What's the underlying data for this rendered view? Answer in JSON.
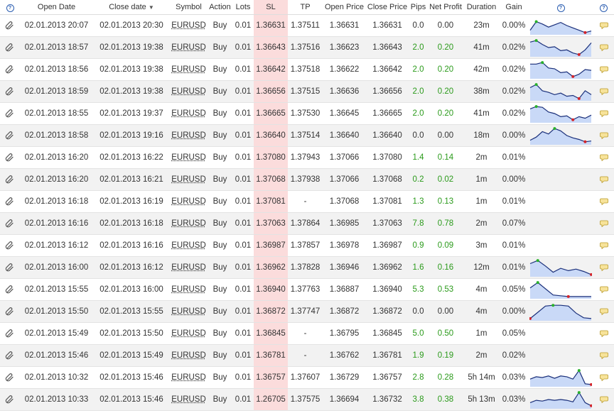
{
  "header": {
    "help_left": "?",
    "open_date": "Open Date",
    "close_date": "Close date",
    "sort_indicator": "▼",
    "symbol": "Symbol",
    "action": "Action",
    "lots": "Lots",
    "sl": "SL",
    "tp": "TP",
    "open_price": "Open Price",
    "close_price": "Close Price",
    "pips": "Pips",
    "net_profit": "Net Profit",
    "duration": "Duration",
    "gain": "Gain",
    "help_chart": "?",
    "help_right": "?"
  },
  "icons": {
    "row_left": "paperclip-icon",
    "row_right": "comment-bubble-icon"
  },
  "colors": {
    "sl_highlight": "#fbdcdc",
    "positive": "#2a9a1a",
    "spark_fill": "#c9d9f7",
    "spark_line": "#1a2f7a"
  },
  "rows": [
    {
      "open_date": "02.01.2013 20:07",
      "close_date": "02.01.2013 20:30",
      "symbol": "EURUSD",
      "action": "Buy",
      "lots": "0.01",
      "sl": "1.36631",
      "tp": "1.37511",
      "open_price": "1.36631",
      "close_price": "1.36631",
      "pips": "0.0",
      "net_profit": "0.00",
      "duration": "23m",
      "gain": "0.00%",
      "spark": [
        0.2,
        0.75,
        0.6,
        0.4,
        0.55,
        0.7,
        0.5,
        0.35,
        0.2,
        0.05,
        0.15
      ]
    },
    {
      "open_date": "02.01.2013 18:57",
      "close_date": "02.01.2013 19:38",
      "symbol": "EURUSD",
      "action": "Buy",
      "lots": "0.01",
      "sl": "1.36643",
      "tp": "1.37516",
      "open_price": "1.36623",
      "close_price": "1.36643",
      "pips": "2.0",
      "net_profit": "0.20",
      "duration": "41m",
      "gain": "0.02%",
      "spark": [
        0.85,
        0.95,
        0.7,
        0.5,
        0.55,
        0.3,
        0.35,
        0.15,
        0.05,
        0.35,
        0.8
      ]
    },
    {
      "open_date": "02.01.2013 18:56",
      "close_date": "02.01.2013 19:38",
      "symbol": "EURUSD",
      "action": "Buy",
      "lots": "0.01",
      "sl": "1.36642",
      "tp": "1.37518",
      "open_price": "1.36622",
      "close_price": "1.36642",
      "pips": "2.0",
      "net_profit": "0.20",
      "duration": "42m",
      "gain": "0.02%",
      "spark": [
        0.85,
        0.85,
        0.95,
        0.6,
        0.55,
        0.3,
        0.35,
        0.05,
        0.2,
        0.5,
        0.45
      ]
    },
    {
      "open_date": "02.01.2013 18:59",
      "close_date": "02.01.2013 19:38",
      "symbol": "EURUSD",
      "action": "Buy",
      "lots": "0.01",
      "sl": "1.36656",
      "tp": "1.37515",
      "open_price": "1.36636",
      "close_price": "1.36656",
      "pips": "2.0",
      "net_profit": "0.20",
      "duration": "38m",
      "gain": "0.02%",
      "spark": [
        0.75,
        0.95,
        0.55,
        0.45,
        0.3,
        0.4,
        0.2,
        0.25,
        0.05,
        0.55,
        0.3
      ]
    },
    {
      "open_date": "02.01.2013 18:55",
      "close_date": "02.01.2013 19:37",
      "symbol": "EURUSD",
      "action": "Buy",
      "lots": "0.01",
      "sl": "1.36665",
      "tp": "1.37530",
      "open_price": "1.36645",
      "close_price": "1.36665",
      "pips": "2.0",
      "net_profit": "0.20",
      "duration": "41m",
      "gain": "0.02%",
      "spark": [
        0.8,
        0.95,
        0.9,
        0.6,
        0.5,
        0.3,
        0.35,
        0.1,
        0.3,
        0.2,
        0.4
      ]
    },
    {
      "open_date": "02.01.2013 18:58",
      "close_date": "02.01.2013 19:16",
      "symbol": "EURUSD",
      "action": "Buy",
      "lots": "0.01",
      "sl": "1.36640",
      "tp": "1.37514",
      "open_price": "1.36640",
      "close_price": "1.36640",
      "pips": "0.0",
      "net_profit": "0.00",
      "duration": "18m",
      "gain": "0.00%",
      "spark": [
        0.2,
        0.4,
        0.75,
        0.6,
        0.95,
        0.8,
        0.5,
        0.35,
        0.25,
        0.1,
        0.15
      ]
    },
    {
      "open_date": "02.01.2013 16:20",
      "close_date": "02.01.2013 16:22",
      "symbol": "EURUSD",
      "action": "Buy",
      "lots": "0.01",
      "sl": "1.37080",
      "tp": "1.37943",
      "open_price": "1.37066",
      "close_price": "1.37080",
      "pips": "1.4",
      "net_profit": "0.14",
      "duration": "2m",
      "gain": "0.01%",
      "spark": null
    },
    {
      "open_date": "02.01.2013 16:20",
      "close_date": "02.01.2013 16:21",
      "symbol": "EURUSD",
      "action": "Buy",
      "lots": "0.01",
      "sl": "1.37068",
      "tp": "1.37938",
      "open_price": "1.37066",
      "close_price": "1.37068",
      "pips": "0.2",
      "net_profit": "0.02",
      "duration": "1m",
      "gain": "0.00%",
      "spark": null
    },
    {
      "open_date": "02.01.2013 16:18",
      "close_date": "02.01.2013 16:19",
      "symbol": "EURUSD",
      "action": "Buy",
      "lots": "0.01",
      "sl": "1.37081",
      "tp": "-",
      "open_price": "1.37068",
      "close_price": "1.37081",
      "pips": "1.3",
      "net_profit": "0.13",
      "duration": "1m",
      "gain": "0.01%",
      "spark": null
    },
    {
      "open_date": "02.01.2013 16:16",
      "close_date": "02.01.2013 16:18",
      "symbol": "EURUSD",
      "action": "Buy",
      "lots": "0.01",
      "sl": "1.37063",
      "tp": "1.37864",
      "open_price": "1.36985",
      "close_price": "1.37063",
      "pips": "7.8",
      "net_profit": "0.78",
      "duration": "2m",
      "gain": "0.07%",
      "spark": null
    },
    {
      "open_date": "02.01.2013 16:12",
      "close_date": "02.01.2013 16:16",
      "symbol": "EURUSD",
      "action": "Buy",
      "lots": "0.01",
      "sl": "1.36987",
      "tp": "1.37857",
      "open_price": "1.36978",
      "close_price": "1.36987",
      "pips": "0.9",
      "net_profit": "0.09",
      "duration": "3m",
      "gain": "0.01%",
      "spark": null
    },
    {
      "open_date": "02.01.2013 16:00",
      "close_date": "02.01.2013 16:12",
      "symbol": "EURUSD",
      "action": "Buy",
      "lots": "0.01",
      "sl": "1.36962",
      "tp": "1.37828",
      "open_price": "1.36946",
      "close_price": "1.36962",
      "pips": "1.6",
      "net_profit": "0.16",
      "duration": "12m",
      "gain": "0.01%",
      "spark": [
        0.75,
        0.95,
        0.6,
        0.2,
        0.45,
        0.3,
        0.4,
        0.25,
        0.05
      ]
    },
    {
      "open_date": "02.01.2013 15:55",
      "close_date": "02.01.2013 16:00",
      "symbol": "EURUSD",
      "action": "Buy",
      "lots": "0.01",
      "sl": "1.36940",
      "tp": "1.37763",
      "open_price": "1.36887",
      "close_price": "1.36940",
      "pips": "5.3",
      "net_profit": "0.53",
      "duration": "4m",
      "gain": "0.05%",
      "spark": [
        0.6,
        0.95,
        0.55,
        0.15,
        0.1,
        0.05,
        0.05,
        0.05,
        0.05
      ]
    },
    {
      "open_date": "02.01.2013 15:50",
      "close_date": "02.01.2013 15:55",
      "symbol": "EURUSD",
      "action": "Buy",
      "lots": "0.01",
      "sl": "1.36872",
      "tp": "1.37747",
      "open_price": "1.36872",
      "close_price": "1.36872",
      "pips": "0.0",
      "net_profit": "0.00",
      "duration": "4m",
      "gain": "0.00%",
      "spark": [
        0.05,
        0.45,
        0.85,
        0.9,
        0.9,
        0.85,
        0.4,
        0.1,
        0.05
      ]
    },
    {
      "open_date": "02.01.2013 15:49",
      "close_date": "02.01.2013 15:50",
      "symbol": "EURUSD",
      "action": "Buy",
      "lots": "0.01",
      "sl": "1.36845",
      "tp": "-",
      "open_price": "1.36795",
      "close_price": "1.36845",
      "pips": "5.0",
      "net_profit": "0.50",
      "duration": "1m",
      "gain": "0.05%",
      "spark": null
    },
    {
      "open_date": "02.01.2013 15:46",
      "close_date": "02.01.2013 15:49",
      "symbol": "EURUSD",
      "action": "Buy",
      "lots": "0.01",
      "sl": "1.36781",
      "tp": "-",
      "open_price": "1.36762",
      "close_price": "1.36781",
      "pips": "1.9",
      "net_profit": "0.19",
      "duration": "2m",
      "gain": "0.02%",
      "spark": null
    },
    {
      "open_date": "02.01.2013 10:32",
      "close_date": "02.01.2013 15:46",
      "symbol": "EURUSD",
      "action": "Buy",
      "lots": "0.01",
      "sl": "1.36757",
      "tp": "1.37607",
      "open_price": "1.36729",
      "close_price": "1.36757",
      "pips": "2.8",
      "net_profit": "0.28",
      "duration": "5h 14m",
      "gain": "0.03%",
      "spark": [
        0.4,
        0.55,
        0.5,
        0.6,
        0.45,
        0.6,
        0.55,
        0.4,
        0.95,
        0.1,
        0.05
      ]
    },
    {
      "open_date": "02.01.2013 10:33",
      "close_date": "02.01.2013 15:46",
      "symbol": "EURUSD",
      "action": "Buy",
      "lots": "0.01",
      "sl": "1.26705",
      "tp": "1.37575",
      "open_price": "1.36694",
      "close_price": "1.36732",
      "pips": "3.8",
      "net_profit": "0.38",
      "duration": "5h 13m",
      "gain": "0.03%",
      "spark": [
        0.3,
        0.45,
        0.4,
        0.5,
        0.45,
        0.5,
        0.45,
        0.35,
        0.95,
        0.3,
        0.1
      ]
    }
  ]
}
